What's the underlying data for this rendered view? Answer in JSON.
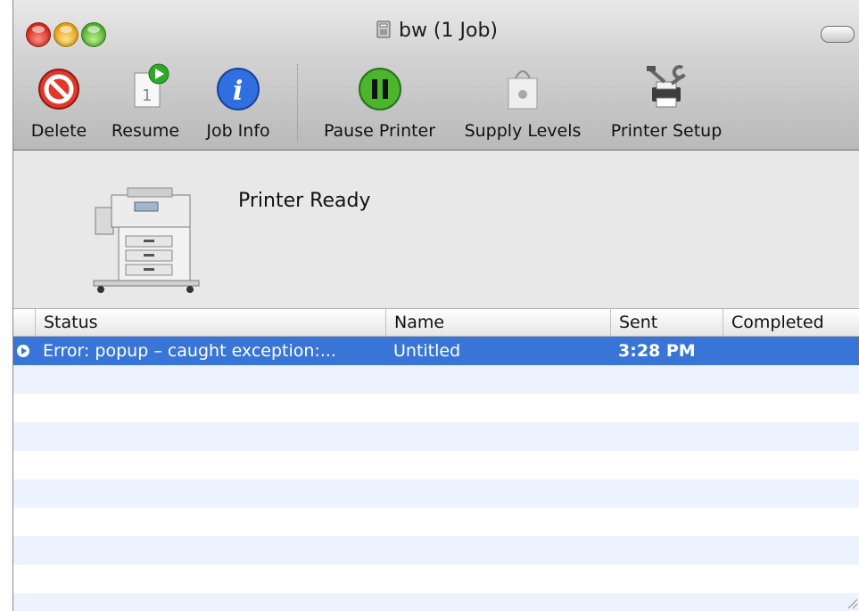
{
  "window": {
    "title": "bw (1 Job)"
  },
  "toolbar": {
    "delete": "Delete",
    "resume": "Resume",
    "job_info": "Job Info",
    "pause_printer": "Pause Printer",
    "supply_levels": "Supply Levels",
    "printer_setup": "Printer Setup"
  },
  "printer": {
    "status": "Printer Ready"
  },
  "job_list": {
    "columns": [
      "Status",
      "Name",
      "Sent",
      "Completed"
    ],
    "jobs": [
      {
        "status": "Error: popup – caught exception:...",
        "name": "Untitled",
        "sent": "3:28 PM",
        "completed": "",
        "selected": true
      }
    ]
  },
  "colors": {
    "selection": "#3875d7",
    "stripe": "#edf3fe"
  }
}
